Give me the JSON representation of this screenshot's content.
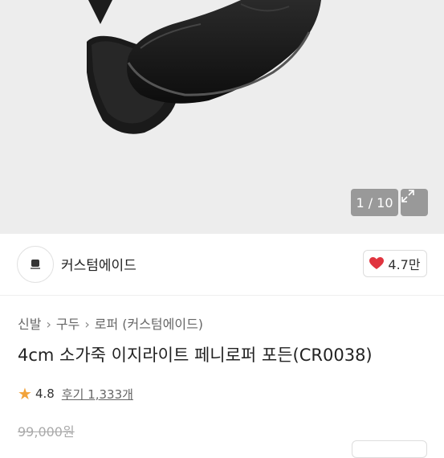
{
  "gallery": {
    "counter": "1 / 10"
  },
  "store": {
    "name": "커스텀에이드",
    "likes": "4.7만"
  },
  "breadcrumb": [
    "신발",
    "구두",
    "로퍼 (커스텀에이드)"
  ],
  "product": {
    "title": "4cm 소가죽 이지라이트 페니로퍼 포든(CR0038)",
    "rating": "4.8",
    "reviews": "후기 1,333개",
    "original_price": "99,000원"
  },
  "colors": {
    "heart": "#e0343f",
    "star": "#f2a33a"
  }
}
